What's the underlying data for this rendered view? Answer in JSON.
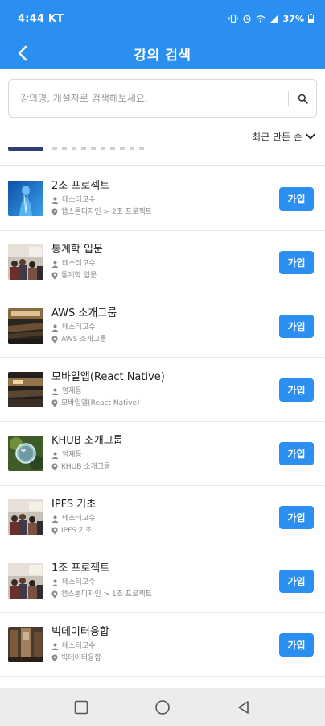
{
  "status_bar": {
    "time": "4:44 KT",
    "battery": "37%",
    "icons": [
      "vibrate-icon",
      "alarm-icon",
      "wifi-icon",
      "signal-icon",
      "battery-icon"
    ]
  },
  "app_bar": {
    "title": "강의 검색",
    "back_icon": "chevron-left-icon"
  },
  "search": {
    "placeholder": "강의명, 개설자로 검색해보세요.",
    "value": "",
    "icon": "search-icon"
  },
  "sort": {
    "label": "최근 만든 순",
    "icon": "chevron-down-icon"
  },
  "courses": [
    {
      "name": "2조 프로젝트",
      "owner": "테스터교수",
      "path": "캡스톤디자인 > 2조 프로젝트",
      "join_label": "가입",
      "thumb": "blue-figure"
    },
    {
      "name": "통계학 입문",
      "owner": "테스터교수",
      "path": "통계학 입문",
      "join_label": "가입",
      "thumb": "classroom"
    },
    {
      "name": "AWS 소개그룹",
      "owner": "테스터교수",
      "path": "AWS 소개그룹",
      "join_label": "가입",
      "thumb": "lecture-hall"
    },
    {
      "name": "모바일앱(React Native)",
      "owner": "엄재동",
      "path": "모바일앱(React Native)",
      "join_label": "가입",
      "thumb": "dark-room"
    },
    {
      "name": "KHUB 소개그룹",
      "owner": "엄재동",
      "path": "KHUB 소개그룹",
      "join_label": "가입",
      "thumb": "globe-nature"
    },
    {
      "name": "IPFS 기초",
      "owner": "테스터교수",
      "path": "IPFS 기초",
      "join_label": "가입",
      "thumb": "classroom"
    },
    {
      "name": "1조 프로젝트",
      "owner": "테스터교수",
      "path": "캡스톤디자인 > 1조 프로젝트",
      "join_label": "가입",
      "thumb": "classroom"
    },
    {
      "name": "빅데이터융합",
      "owner": "테스터교수",
      "path": "빅데이터융합",
      "join_label": "가입",
      "thumb": "library"
    }
  ],
  "nav_bar": {
    "icons": [
      "recents-square-icon",
      "home-circle-icon",
      "back-triangle-icon"
    ]
  },
  "colors": {
    "brand_blue": "#2a8ff0",
    "divider": "#e6e6e6",
    "meta_gray": "#8a8a8a",
    "nav_bg": "#ececec"
  }
}
